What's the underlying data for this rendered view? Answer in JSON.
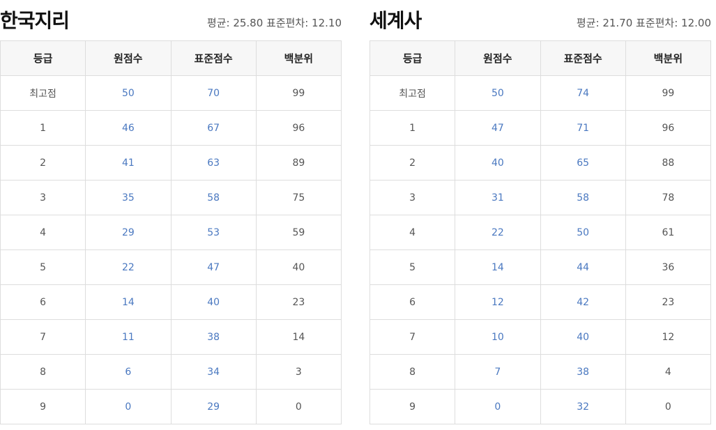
{
  "columns": [
    "등급",
    "원점수",
    "표준점수",
    "백분위"
  ],
  "left": {
    "title": "한국지리",
    "stats": "평균: 25.80 표준편차: 12.10",
    "rows": [
      [
        "최고점",
        "50",
        "70",
        "99"
      ],
      [
        "1",
        "46",
        "67",
        "96"
      ],
      [
        "2",
        "41",
        "63",
        "89"
      ],
      [
        "3",
        "35",
        "58",
        "75"
      ],
      [
        "4",
        "29",
        "53",
        "59"
      ],
      [
        "5",
        "22",
        "47",
        "40"
      ],
      [
        "6",
        "14",
        "40",
        "23"
      ],
      [
        "7",
        "11",
        "38",
        "14"
      ],
      [
        "8",
        "6",
        "34",
        "3"
      ],
      [
        "9",
        "0",
        "29",
        "0"
      ]
    ]
  },
  "right": {
    "title": "세계사",
    "stats": "평균: 21.70 표준편차: 12.00",
    "rows": [
      [
        "최고점",
        "50",
        "74",
        "99"
      ],
      [
        "1",
        "47",
        "71",
        "96"
      ],
      [
        "2",
        "40",
        "65",
        "88"
      ],
      [
        "3",
        "31",
        "58",
        "78"
      ],
      [
        "4",
        "22",
        "50",
        "61"
      ],
      [
        "5",
        "14",
        "44",
        "36"
      ],
      [
        "6",
        "12",
        "42",
        "23"
      ],
      [
        "7",
        "10",
        "40",
        "12"
      ],
      [
        "8",
        "7",
        "38",
        "4"
      ],
      [
        "9",
        "0",
        "32",
        "0"
      ]
    ]
  },
  "colors": {
    "score_blue": "#4a78c0",
    "text": "#555555",
    "header_bg": "#f7f7f7"
  }
}
